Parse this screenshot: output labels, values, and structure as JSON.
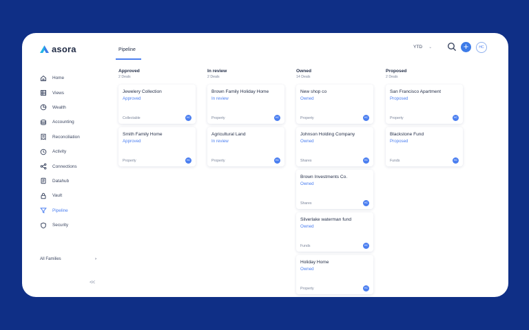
{
  "app": {
    "name": "asora"
  },
  "sidebar": {
    "items": [
      {
        "label": "Home",
        "icon": "home-icon"
      },
      {
        "label": "Views",
        "icon": "grid-icon"
      },
      {
        "label": "Wealth",
        "icon": "pie-chart-icon"
      },
      {
        "label": "Accounting",
        "icon": "coins-icon"
      },
      {
        "label": "Reconciliation",
        "icon": "receipt-icon"
      },
      {
        "label": "Activity",
        "icon": "clock-icon"
      },
      {
        "label": "Connections",
        "icon": "share-icon"
      },
      {
        "label": "Datahub",
        "icon": "database-icon"
      },
      {
        "label": "Vault",
        "icon": "lock-icon"
      },
      {
        "label": "Pipeline",
        "icon": "funnel-icon",
        "active": true
      },
      {
        "label": "Security",
        "icon": "shield-icon"
      }
    ],
    "families_label": "All Families",
    "families_chevron": "›",
    "collapse_label": "<<"
  },
  "header": {
    "tab_label": "Pipeline",
    "period_label": "YTD",
    "period_chevron": "⌄",
    "add_label": "+",
    "avatar_initials": "HC"
  },
  "board": {
    "columns": [
      {
        "title": "Approved",
        "count": "2 Deals",
        "cards": [
          {
            "title": "Jewelery Collection",
            "status": "Approved",
            "type": "Collectable",
            "badge": "HC"
          },
          {
            "title": "Smith Family Home",
            "status": "Approved",
            "type": "Property",
            "badge": "HC"
          }
        ]
      },
      {
        "title": "In review",
        "count": "2 Deals",
        "cards": [
          {
            "title": "Brown Family Holiday Home",
            "status": "In review",
            "type": "Property",
            "badge": "HC"
          },
          {
            "title": "Agricultural Land",
            "status": "In review",
            "type": "Property",
            "badge": "HC"
          }
        ]
      },
      {
        "title": "Owned",
        "count": "14 Deals",
        "cards": [
          {
            "title": "New shop co",
            "status": "Owned",
            "type": "Property",
            "badge": "HC"
          },
          {
            "title": "Johnson Holding Company",
            "status": "Owned",
            "type": "Shares",
            "badge": "HC"
          },
          {
            "title": "Brown Investments Co.",
            "status": "Owned",
            "type": "Shares",
            "badge": "HC"
          },
          {
            "title": "Silverlake waterman fund",
            "status": "Owned",
            "type": "Funds",
            "badge": "HC"
          },
          {
            "title": "Holiday Home",
            "status": "Owned",
            "type": "Property",
            "badge": "HC"
          }
        ]
      },
      {
        "title": "Proposed",
        "count": "2 Deals",
        "cards": [
          {
            "title": "San Francisco Apartment",
            "status": "Proposed",
            "type": "Property",
            "badge": "HC"
          },
          {
            "title": "Blackstone Fund",
            "status": "Proposed",
            "type": "Funds",
            "badge": "HC"
          }
        ]
      }
    ]
  },
  "colors": {
    "background": "#0f2f86",
    "accent": "#4a7ef0",
    "text": "#1f2a44"
  }
}
